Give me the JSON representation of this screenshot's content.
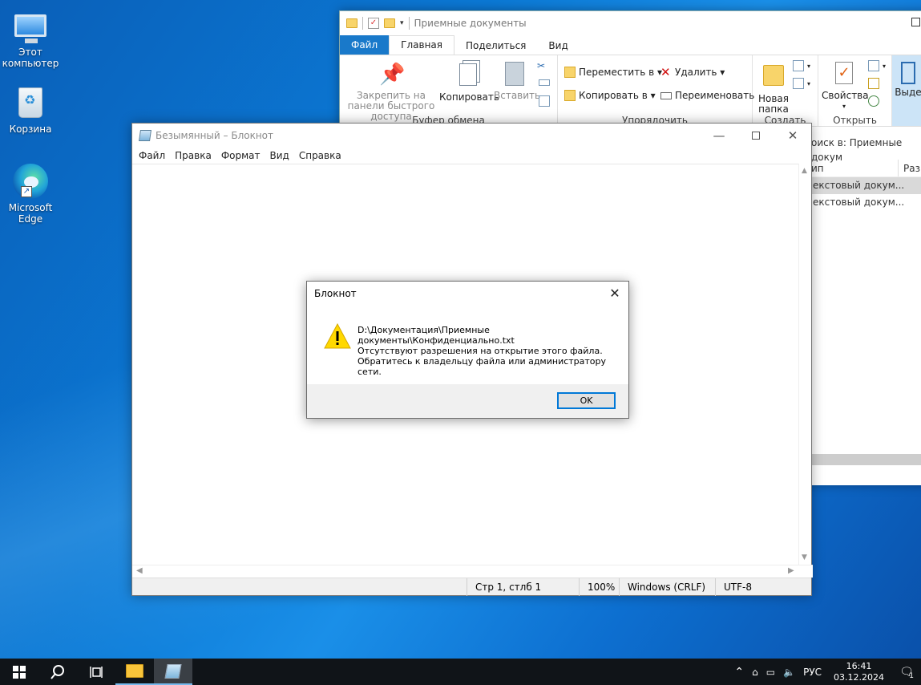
{
  "desktop": {
    "icons": [
      {
        "label": "Этот компьютер"
      },
      {
        "label": "Корзина"
      },
      {
        "label": "Microsoft Edge"
      }
    ]
  },
  "explorer": {
    "title": "Приемные документы",
    "tabs": [
      "Файл",
      "Главная",
      "Поделиться",
      "Вид"
    ],
    "clipboard": {
      "pin_label": "Закрепить на панели быстрого доступа",
      "copy_label": "Копировать",
      "paste_label": "Вставить",
      "group_name": "Буфер обмена"
    },
    "organize": {
      "move_label": "Переместить в ▾",
      "copy_to_label": "Копировать в ▾",
      "delete_label": "Удалить ▾",
      "rename_label": "Переименовать",
      "group_name": "Упорядочить"
    },
    "create": {
      "new_folder_label": "Новая папка",
      "group_name": "Создать"
    },
    "open": {
      "properties_label": "Свойства",
      "group_name": "Открыть"
    },
    "select_partial": "Выде",
    "search_text": "оиск в: Приемные докум",
    "columns": [
      "ип",
      "Разм"
    ],
    "rows": [
      "екстовый докум...",
      "екстовый докум..."
    ]
  },
  "notepad": {
    "title": "Безымянный – Блокнот",
    "menu": [
      "Файл",
      "Правка",
      "Формат",
      "Вид",
      "Справка"
    ],
    "status": {
      "position": "Стр 1, стлб 1",
      "zoom": "100%",
      "line_endings": "Windows (CRLF)",
      "encoding": "UTF-8"
    }
  },
  "dialog": {
    "title": "Блокнот",
    "path_line1": "D:\\Документация\\Приемные",
    "path_line2": "документы\\Конфиденциально.txt",
    "message_line1": "Отсутствуют разрешения на открытие этого файла.",
    "message_line2": "Обратитесь к владельцу файла или администратору сети.",
    "ok_label": "OK"
  },
  "taskbar": {
    "language": "РУС",
    "time": "16:41",
    "date": "03.12.2024",
    "notification_count": "1"
  },
  "colors": {
    "accent": "#0078d7",
    "file_tab": "#1979ca",
    "taskbar": "#101418"
  }
}
